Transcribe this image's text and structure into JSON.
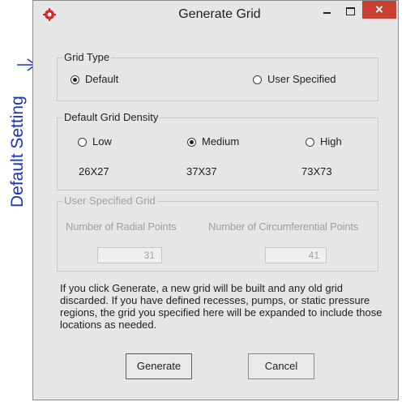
{
  "annotation": {
    "text": "Default Setting",
    "color": "#1a31c8"
  },
  "window": {
    "title": "Generate Grid",
    "close_glyph": "×",
    "icons": [
      "app-gear-icon",
      "minimize-icon",
      "maximize-icon",
      "close-icon"
    ],
    "close_color": "#c84031"
  },
  "grid_type": {
    "legend": "Grid Type",
    "options": [
      {
        "label": "Default",
        "selected": true
      },
      {
        "label": "User Specified",
        "selected": false
      }
    ]
  },
  "density": {
    "legend": "Default Grid Density",
    "options": [
      {
        "label": "Low",
        "dims": "26X27",
        "selected": false
      },
      {
        "label": "Medium",
        "dims": "37X37",
        "selected": true
      },
      {
        "label": "High",
        "dims": "73X73",
        "selected": false
      }
    ]
  },
  "user_grid": {
    "legend": "User Specified Grid",
    "enabled": false,
    "radial_label": "Number of Radial Points",
    "radial_value": "31",
    "circ_label": "Number of Circumferential Points",
    "circ_value": "41"
  },
  "note": "If you click Generate, a new grid will be built and any old grid discarded. If you have defined recesses, pumps, or static pressure regions, the grid you specified here will be expanded to include those locations as needed.",
  "buttons": {
    "generate": "Generate",
    "cancel": "Cancel"
  }
}
